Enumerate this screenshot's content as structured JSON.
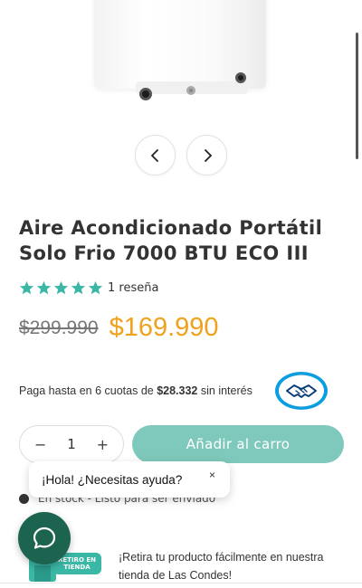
{
  "product": {
    "title": "Aire Acondicionado Portátil Solo Frio 7000 BTU ECO III",
    "rating_text": "1 reseña",
    "rating_stars": 5,
    "old_price": "$299.990",
    "new_price": "$169.990",
    "installments_prefix": "Paga hasta en 6 cuotas de ",
    "installments_amount": "$28.332",
    "installments_suffix": " sin interés"
  },
  "gallery": {
    "prev_icon": "chevron-left-icon",
    "next_icon": "chevron-right-icon"
  },
  "purchase": {
    "qty_minus": "−",
    "qty_value": "1",
    "qty_plus": "+",
    "add_to_cart": "Añadir al carro"
  },
  "stock": {
    "text": "En stock - Listo para ser enviado"
  },
  "chat": {
    "greeting": "¡Hola! ¿Necesitas ayuda?",
    "close": "×"
  },
  "pickup": {
    "badge_line1": "RETIRO EN",
    "badge_line2": "TIENDA",
    "text": "¡Retira tu producto fácilmente en nuestra tienda de Las Condes!"
  },
  "colors": {
    "accent": "#7ec9bb",
    "price": "#f0a21c",
    "star": "#3bb7a6",
    "chat": "#1d6450"
  }
}
